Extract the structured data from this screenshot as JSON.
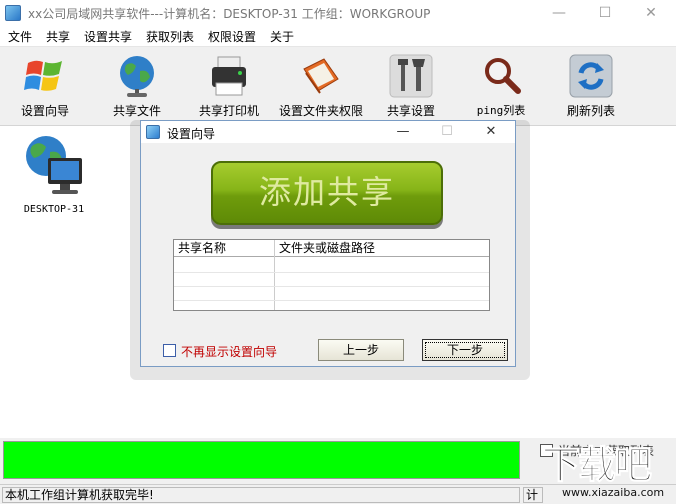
{
  "window": {
    "title": "xx公司局域网共享软件---计算机名：DESKTOP-31   工作组：WORKGROUP",
    "minimize": "—",
    "maximize": "☐",
    "close": "✕"
  },
  "menu": [
    "文件",
    "共享",
    "设置共享",
    "获取列表",
    "权限设置",
    "关于"
  ],
  "toolbar": [
    {
      "label": "设置向导",
      "icon": "windows-logo-icon"
    },
    {
      "label": "共享文件",
      "icon": "globe-icon"
    },
    {
      "label": "共享打印机",
      "icon": "printer-icon"
    },
    {
      "label": "设置文件夹权限",
      "icon": "folder-book-icon"
    },
    {
      "label": "共享设置",
      "icon": "tools-icon"
    },
    {
      "label": "ping列表",
      "icon": "magnifier-icon"
    },
    {
      "label": "刷新列表",
      "icon": "refresh-icon"
    }
  ],
  "computers": [
    {
      "name": "DESKTOP-31"
    }
  ],
  "dialog": {
    "title": "设置向导",
    "minimize": "—",
    "maximize": "☐",
    "close": "✕",
    "add_button": "添加共享",
    "columns": [
      "共享名称",
      "文件夹或磁盘路径"
    ],
    "checkbox_label": "不再显示设置向导",
    "prev_button": "上一步",
    "next_button": "下一步"
  },
  "progress": {
    "percent": 100,
    "color": "#00ff00"
  },
  "right_checkbox_label": "当前方式获取列表",
  "status": {
    "main": "本机工作组计算机获取完毕!",
    "right": "计"
  },
  "watermark": {
    "brand": "下载吧",
    "url": "www.xiazaiba.com"
  },
  "colors": {
    "accent_green": "#86b418",
    "progress": "#00ff00",
    "warn_text": "#c00000"
  }
}
